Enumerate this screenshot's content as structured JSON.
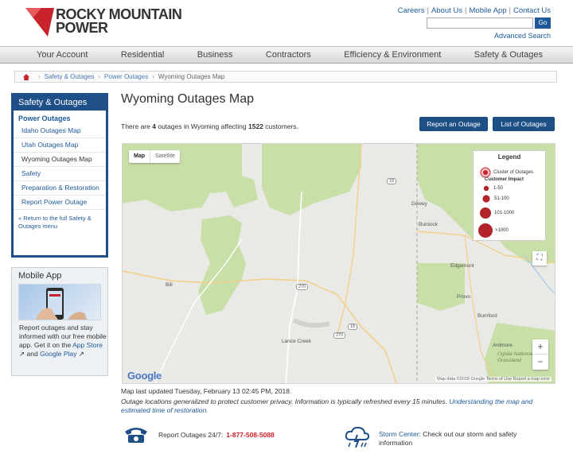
{
  "header": {
    "logo_line1": "ROCKY MOUNTAIN",
    "logo_line2": "POWER",
    "top_links": [
      "Careers",
      "About Us",
      "Mobile App",
      "Contact Us"
    ],
    "search_button": "Go",
    "advanced_search": "Advanced Search"
  },
  "nav": {
    "items": [
      "Your Account",
      "Residential",
      "Business",
      "Contractors",
      "Efficiency & Environment",
      "Safety & Outages"
    ]
  },
  "breadcrumb": {
    "items": [
      "Safety & Outages",
      "Power Outages",
      "Wyoming Outages Map"
    ]
  },
  "sidebar": {
    "title": "Safety & Outages",
    "subtitle": "Power Outages",
    "links": [
      "Idaho Outages Map",
      "Utah Outages Map",
      "Wyoming Outages Map",
      "Safety",
      "Preparation & Restoration",
      "Report Power Outage"
    ],
    "back_link": "« Return to the full Safety & Outages menu"
  },
  "mobile_app": {
    "title": "Mobile App",
    "text": "Report outages and stay informed with our free mobile app. Get it on the",
    "app_store": "App Store",
    "and": "and",
    "google_play": "Google Play"
  },
  "main": {
    "title": "Wyoming Outages Map",
    "summary_prefix": "There are",
    "outage_count": "4",
    "summary_middle": "outages in Wyoming affecting",
    "customer_count": "1522",
    "summary_suffix": "customers.",
    "report_button": "Report an Outage",
    "list_button": "List of Outages"
  },
  "map": {
    "type_map": "Map",
    "type_satellite": "Satellite",
    "legend_title": "Legend",
    "legend_cluster": "Cluster of Outages",
    "legend_impact_title": "Customer Impact",
    "legend_levels": [
      "1-50",
      "51-100",
      "101-1000",
      ">1000"
    ],
    "places": [
      "Dewey",
      "Burdock",
      "Edgemont",
      "Provo",
      "Bumford",
      "Ardmore",
      "Oglala National Grassland",
      "Lance Creek",
      "Bill"
    ],
    "roads": [
      "270",
      "18",
      "85",
      "270",
      "18"
    ],
    "zoom_in": "+",
    "zoom_out": "−",
    "google": "Google",
    "attribution": "Map data ©2018 Google   Terms of Use   Report a map error"
  },
  "footer": {
    "updated": "Map last updated Tuesday, February 13 02:45 PM, 2018.",
    "note": "Outage locations generalized to protect customer privacy. Information is typically refreshed every 15 minutes.",
    "note_link": "Understanding the map and estimated time of restoration.",
    "report_label": "Report Outages 24/7:",
    "report_phone": "1-877-508-5088",
    "storm_link": "Storm Center:",
    "storm_text": "Check out our storm and safety information"
  }
}
